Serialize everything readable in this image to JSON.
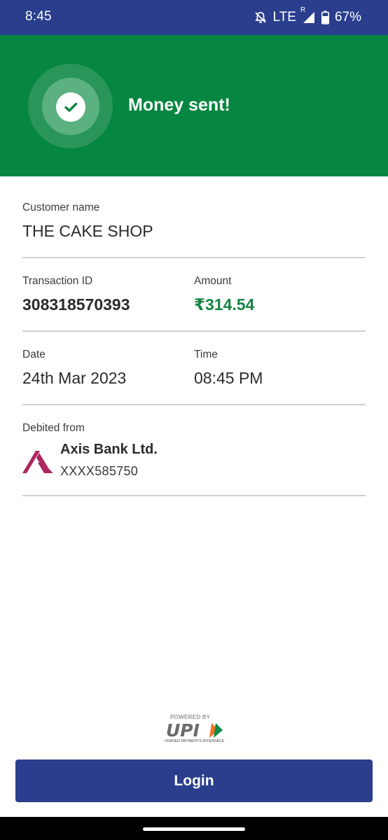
{
  "status_bar": {
    "time": "8:45",
    "network": "LTE",
    "roaming": "R",
    "battery": "67%",
    "icons": [
      "mute-notification-icon",
      "signal-icon",
      "battery-icon"
    ]
  },
  "header": {
    "title": "Money sent!",
    "icon": "checkmark-icon",
    "color": "#058641"
  },
  "details": {
    "customer_name_label": "Customer name",
    "customer_name": "THE CAKE SHOP",
    "transaction_id_label": "Transaction ID",
    "transaction_id": "308318570393",
    "amount_label": "Amount",
    "amount": "₹314.54",
    "date_label": "Date",
    "date": "24th Mar 2023",
    "time_label": "Time",
    "time": "08:45 PM",
    "debited_label": "Debited from",
    "bank_name": "Axis Bank Ltd.",
    "account": "XXXX585750"
  },
  "upi": {
    "powered_by": "POWERED BY",
    "logo_text": "UPI",
    "tagline": "UNIFIED PAYMENTS INTERFACE"
  },
  "actions": {
    "login_label": "Login"
  },
  "colors": {
    "primary": "#2a3e8d",
    "success": "#058641",
    "amount": "#158543",
    "axis_brand": "#ae275f"
  }
}
